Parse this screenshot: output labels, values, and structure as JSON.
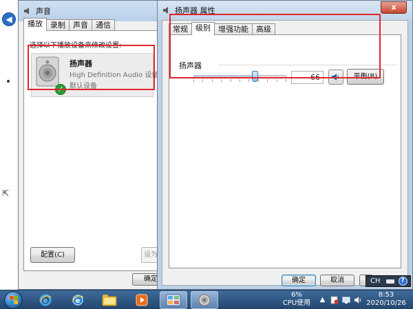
{
  "sound_window": {
    "title": "声音",
    "tabs": [
      "播放",
      "录制",
      "声音",
      "通信"
    ],
    "instruction": "选择以下播放设备来修改设置:",
    "device": {
      "name": "扬声器",
      "description": "High Definition Audio 设备",
      "status": "默认设备"
    },
    "configure_label": "配置(C)",
    "set_default_label": "设为",
    "ok_label": "确定"
  },
  "properties_window": {
    "title": "扬声器 属性",
    "close_label": "x",
    "tabs": [
      "常规",
      "级别",
      "增强功能",
      "高级"
    ],
    "group_label": "扬声器",
    "level": "66",
    "level_fraction": 0.66,
    "balance_label": "平衡(B)",
    "ok_label": "确定",
    "cancel_label": "取消"
  },
  "taskbar": {
    "cpu_percent": "6%",
    "cpu_label": "CPU使用",
    "time": "8:53",
    "date": "2020/10/26"
  },
  "ime": {
    "label": "CH",
    "help_label": "?"
  },
  "colors": {
    "annotation_red": "#e1242a",
    "default_check_green": "#2e9b3a"
  }
}
